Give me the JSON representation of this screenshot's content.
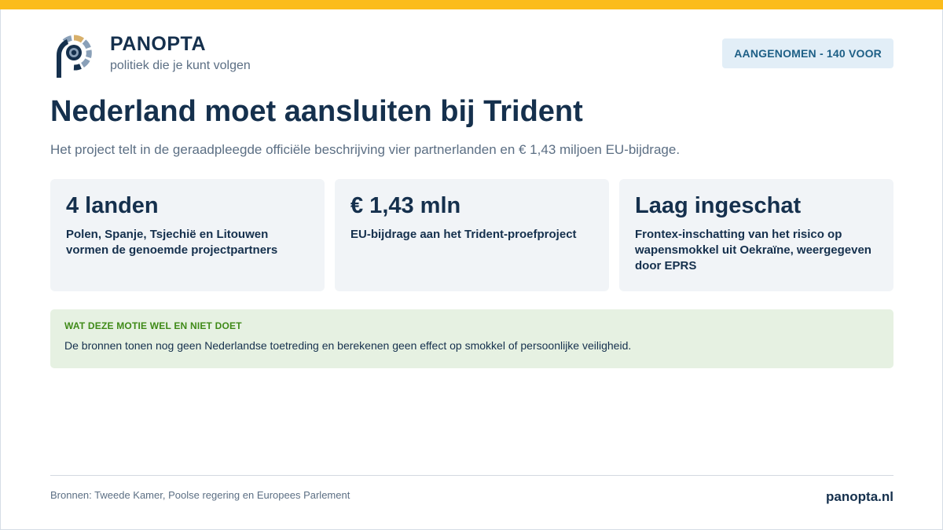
{
  "brand": {
    "name": "PANOPTA",
    "tagline": "politiek die je kunt volgen",
    "colors": {
      "navy": "#15304d",
      "accent": "#fbbc1c",
      "segment_light": "#8aa0b8",
      "segment_gold": "#d8b06a"
    }
  },
  "status_badge": "AANGENOMEN - 140 VOOR",
  "title": "Nederland moet aansluiten bij Trident",
  "subtitle": "Het project telt in de geraadpleegde officiële beschrijving vier partnerlanden en € 1,43 miljoen EU-bijdrage.",
  "stats": [
    {
      "value": "4 landen",
      "description": "Polen, Spanje, Tsjechië en Litouwen vormen de genoemde projectpartners"
    },
    {
      "value": "€ 1,43 mln",
      "description": "EU-bijdrage aan het Trident-proefproject"
    },
    {
      "value": "Laag ingeschat",
      "description": "Frontex-inschatting van het risico op wapensmokkel uit Oekraïne, weergegeven door EPRS"
    }
  ],
  "note": {
    "label": "WAT DEZE MOTIE WEL EN NIET DOET",
    "text": "De bronnen tonen nog geen Nederlandse toetreding en berekenen geen effect op smokkel of persoonlijke veiligheid."
  },
  "footer": {
    "sources": "Bronnen: Tweede Kamer, Poolse regering en Europees Parlement",
    "site": "panopta.nl"
  }
}
